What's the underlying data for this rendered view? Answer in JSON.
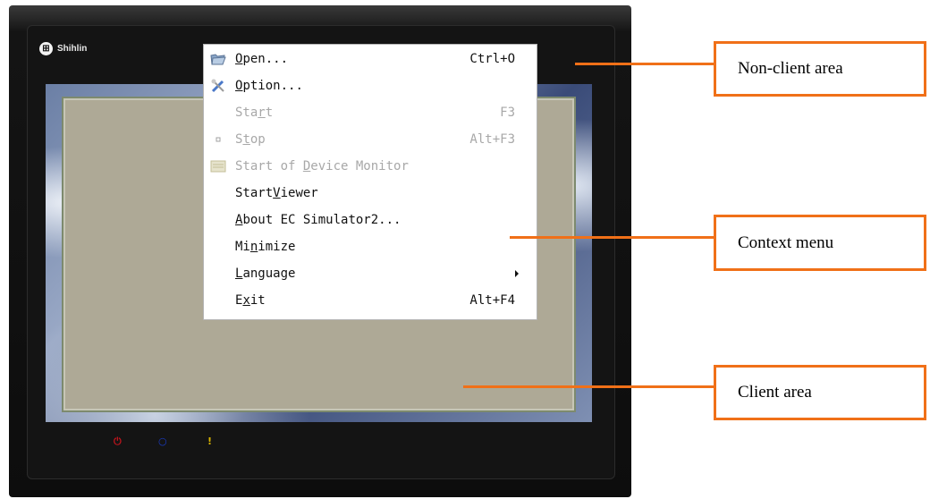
{
  "device": {
    "brand": "Shihlin",
    "brand_icon": "brand-logo-icon",
    "leds": [
      {
        "name": "power-led-icon",
        "glyph": "⏻",
        "color": "#c0141c"
      },
      {
        "name": "connection-led-icon",
        "glyph": "○",
        "color": "#1a3cc8"
      },
      {
        "name": "warning-led-icon",
        "glyph": "!",
        "color": "#d8b400"
      }
    ]
  },
  "context_menu": {
    "items": [
      {
        "label": "Open...",
        "mnemonic_index": 0,
        "shortcut": "Ctrl+O",
        "icon": "folder-open-icon",
        "disabled": false
      },
      {
        "label": "Option...",
        "mnemonic_index": 0,
        "shortcut": "",
        "icon": "tools-icon",
        "disabled": false
      },
      {
        "label": "Start",
        "mnemonic_index": 3,
        "shortcut": "F3",
        "icon": "",
        "disabled": true
      },
      {
        "label": "Stop",
        "mnemonic_index": 1,
        "shortcut": "Alt+F3",
        "icon": "stop-icon",
        "disabled": true
      },
      {
        "label": "Start of Device Monitor",
        "mnemonic_index": 9,
        "shortcut": "",
        "icon": "monitor-icon",
        "disabled": true
      },
      {
        "label": "StartViewer",
        "mnemonic_index": 5,
        "shortcut": "",
        "icon": "",
        "disabled": false
      },
      {
        "label": "About EC Simulator2...",
        "mnemonic_index": 0,
        "shortcut": "",
        "icon": "",
        "disabled": false
      },
      {
        "label": "Minimize",
        "mnemonic_index": 2,
        "shortcut": "",
        "icon": "",
        "disabled": false
      },
      {
        "label": "Language",
        "mnemonic_index": 0,
        "shortcut": "",
        "icon": "",
        "disabled": false,
        "submenu": true
      },
      {
        "label": "Exit",
        "mnemonic_index": 1,
        "shortcut": "Alt+F4",
        "icon": "",
        "disabled": false
      }
    ]
  },
  "callouts": {
    "non_client": "Non-client area",
    "context_menu": "Context menu",
    "client": "Client area"
  },
  "colors": {
    "callout_accent": "#f07018",
    "client_area": "#aea996",
    "disabled_text": "#a8a8a8"
  }
}
